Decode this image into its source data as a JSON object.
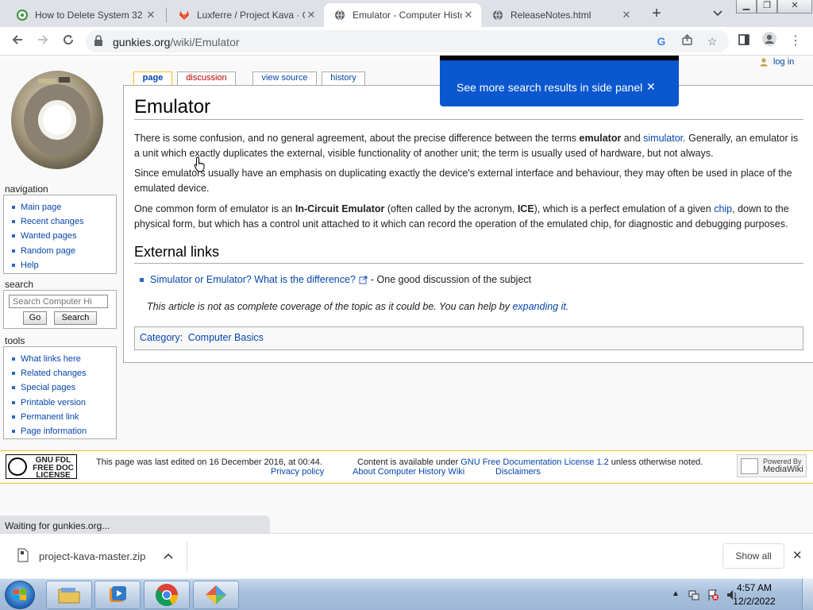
{
  "browser": {
    "tabs": [
      {
        "title": "How to Delete System 32",
        "active": false
      },
      {
        "title": "Luxferre / Project Kava · G",
        "active": false
      },
      {
        "title": "Emulator - Computer Histo",
        "active": true
      },
      {
        "title": "ReleaseNotes.html",
        "active": false
      }
    ],
    "new_tab": "+",
    "tab_list": "⌄",
    "address": {
      "domain": "gunkies.org",
      "path": "/wiki/Emulator"
    }
  },
  "popover": {
    "text": "See more search results in side panel",
    "close": "✕"
  },
  "wiki": {
    "login": "log in",
    "page_tabs": {
      "page": "page",
      "discussion": "discussion",
      "view_source": "view source",
      "history": "history"
    },
    "navigation": {
      "heading": "navigation",
      "items": [
        "Main page",
        "Recent changes",
        "Wanted pages",
        "Random page",
        "Help"
      ]
    },
    "search": {
      "heading": "search",
      "placeholder": "Search Computer Hi",
      "go": "Go",
      "search": "Search"
    },
    "tools": {
      "heading": "tools",
      "items": [
        "What links here",
        "Related changes",
        "Special pages",
        "Printable version",
        "Permanent link",
        "Page information"
      ]
    },
    "article": {
      "title": "Emulator",
      "p1": {
        "t1": "There is some confusion, and no general agreement, about the precise difference between the terms ",
        "b1": "emulator",
        "t2": " and ",
        "link1": "simulator",
        "t3": ". Generally, an emulator is a unit which exactly duplicates the external, visible functionality of another unit; the term is usually used of hardware, but not always."
      },
      "p2": "Since emulators usually have an emphasis on duplicating exactly the device's external interface and behaviour, they may often be used in place of the emulated device.",
      "p3": {
        "t1": "One common form of emulator is an ",
        "b1": "In-Circuit Emulator",
        "t2": " (often called by the acronym, ",
        "b2": "ICE",
        "t3": "), which is a perfect emulation of a given ",
        "link1": "chip",
        "t4": ", down to the physical form, but which has a control unit attached to it which can record the operation of the emulated chip, for diagnostic and debugging purposes."
      },
      "external_heading": "External links",
      "external_link": "Simulator or Emulator? What is the difference?",
      "external_desc": " - One good discussion of the subject",
      "note_text": "This article is not as complete coverage of the topic as it could be. You can help by ",
      "note_link": "expanding it.",
      "category_label": "Category",
      "category_value": "Computer Basics"
    },
    "footer": {
      "gfdl": [
        "GNU FDL",
        "FREE DOC",
        "LICENSE"
      ],
      "last_edited": "This page was last edited on 16 December 2016, at 00:44.",
      "content_pre": "Content is available under ",
      "license_link": "GNU Free Documentation License 1.2",
      "content_post": " unless otherwise noted.",
      "privacy": "Privacy policy",
      "about": "About Computer History Wiki",
      "disclaimers": "Disclaimers",
      "powered": "Powered By",
      "mediawiki": "MediaWiki"
    }
  },
  "status": "Waiting for gunkies.org...",
  "downloads": {
    "file": "project-kava-master.zip",
    "show_all": "Show all",
    "close": "✕"
  },
  "taskbar": {
    "time": "4:57 AM",
    "date": "12/2/2022"
  }
}
